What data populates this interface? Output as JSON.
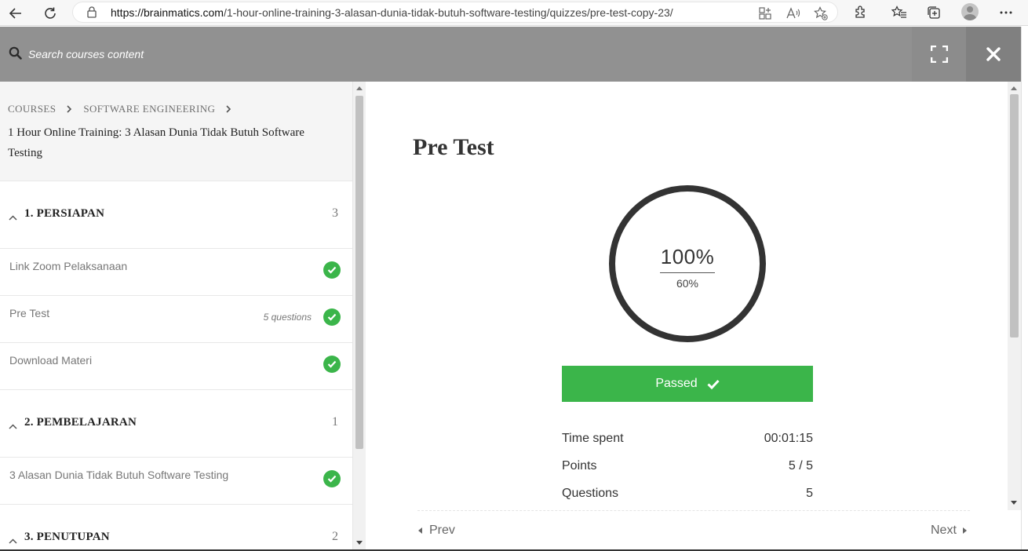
{
  "browser": {
    "url_host": "https://brainmatics.com",
    "url_path": "/1-hour-online-training-3-alasan-dunia-tidak-butuh-software-testing/quizzes/pre-test-copy-23/"
  },
  "header": {
    "search_placeholder": "Search courses content"
  },
  "sidebar": {
    "breadcrumb": [
      "COURSES",
      "SOFTWARE ENGINEERING"
    ],
    "course_title": "1 Hour Online Training: 3 Alasan Dunia Tidak Butuh Software Testing",
    "sections": [
      {
        "title": "1. PERSIAPAN",
        "count": "3",
        "lessons": [
          {
            "title": "Link Zoom Pelaksanaan",
            "meta": "",
            "completed": true
          },
          {
            "title": "Pre Test",
            "meta": "5 questions",
            "completed": true
          },
          {
            "title": "Download Materi",
            "meta": "",
            "completed": true
          }
        ]
      },
      {
        "title": "2. PEMBELAJARAN",
        "count": "1",
        "lessons": [
          {
            "title": "3 Alasan Dunia Tidak Butuh Software Testing",
            "meta": "",
            "completed": true
          }
        ]
      },
      {
        "title": "3. PENUTUPAN",
        "count": "2",
        "lessons": []
      }
    ]
  },
  "quiz": {
    "title": "Pre Test",
    "result_percent": "100%",
    "passing_grade": "60%",
    "status_label": "Passed",
    "stats": [
      {
        "label": "Time spent",
        "value": "00:01:15"
      },
      {
        "label": "Points",
        "value": "5 / 5"
      },
      {
        "label": "Questions",
        "value": "5"
      }
    ],
    "prev_label": "Prev",
    "next_label": "Next"
  },
  "colors": {
    "accent_green": "#3bb54a",
    "header_gray": "#919191"
  }
}
